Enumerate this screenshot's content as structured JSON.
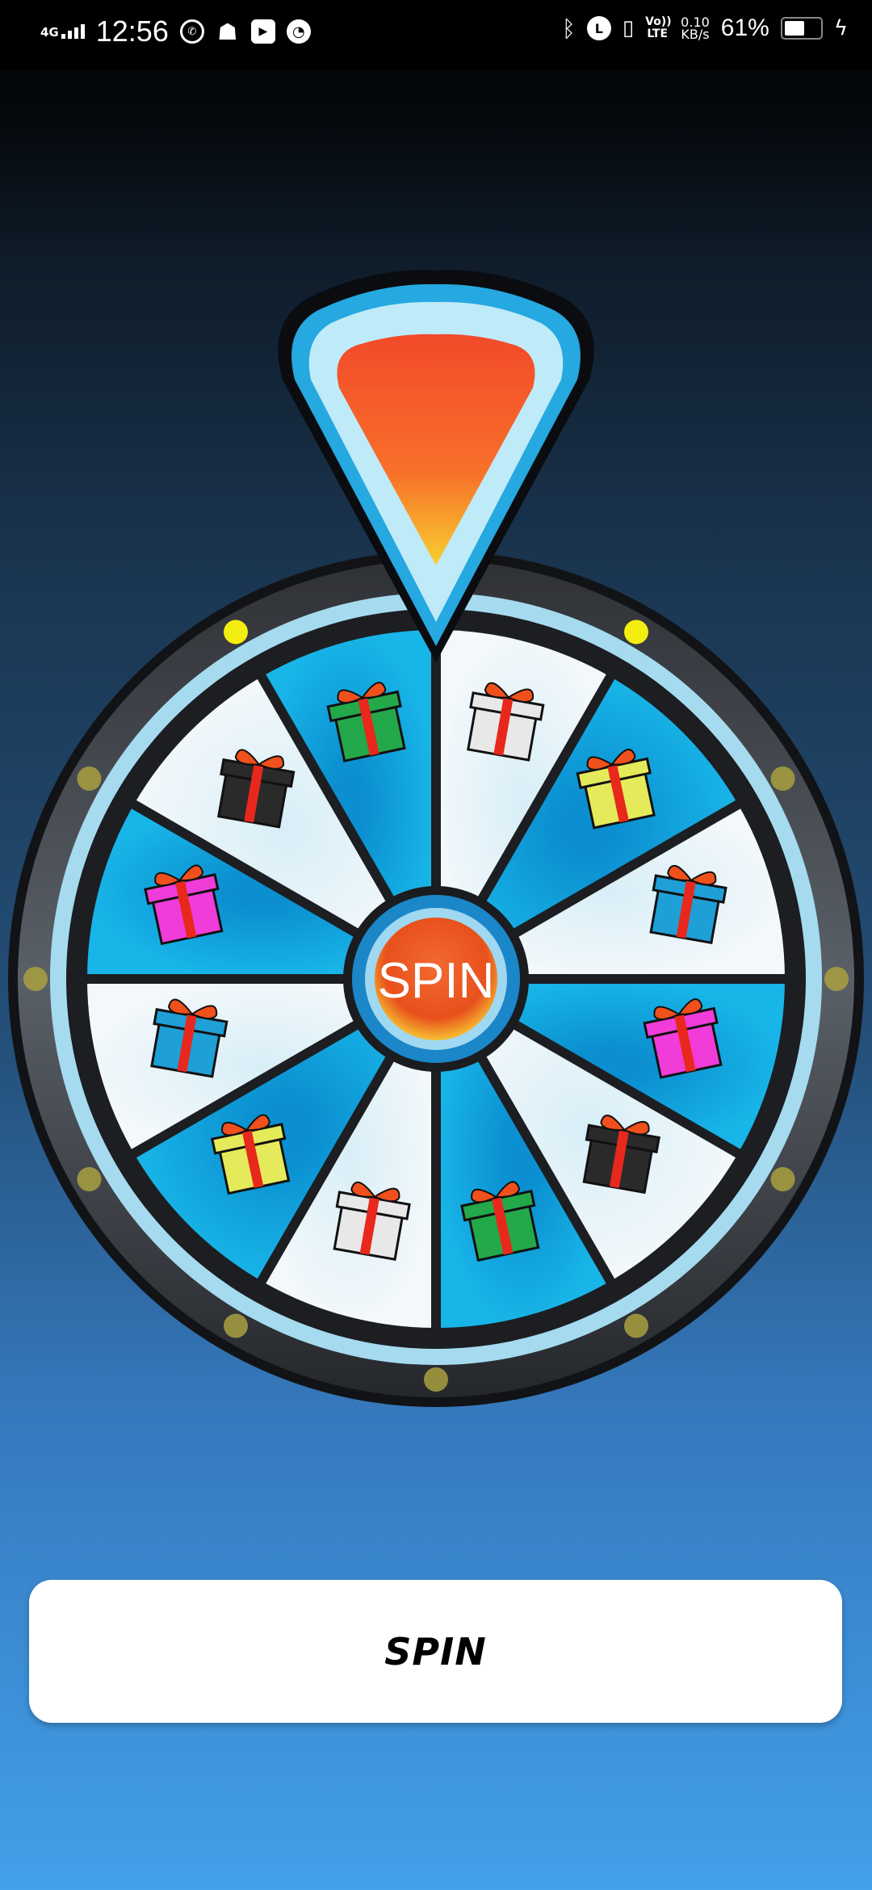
{
  "status_bar": {
    "network": "4G",
    "time": "12:56",
    "app_icons": [
      "whatsapp-icon",
      "snapchat-icon",
      "youtube-icon",
      "speedometer-icon"
    ],
    "system_icons": [
      "bluetooth-icon",
      "alarm-icon",
      "vibrate-icon"
    ],
    "volte": "Vo)) LTE",
    "speed_value": "0.10",
    "speed_unit": "KB/s",
    "battery_percent": "61%",
    "battery_level": 0.61,
    "charging": true
  },
  "wheel": {
    "center_label": "SPIN",
    "colors": {
      "light": "#dbeff7",
      "blue": "#0a9ad8",
      "ring": "#a8dcef",
      "frame": "#2a2c30",
      "hub": "#ef5a24",
      "pointer": "#f25a2a",
      "pointer_frame": "#23a5dc"
    },
    "segments": [
      {
        "shade": "light",
        "gift": "white"
      },
      {
        "shade": "blue",
        "gift": "yellow"
      },
      {
        "shade": "light",
        "gift": "blue"
      },
      {
        "shade": "blue",
        "gift": "pink"
      },
      {
        "shade": "light",
        "gift": "black"
      },
      {
        "shade": "blue",
        "gift": "green"
      },
      {
        "shade": "light",
        "gift": "white"
      },
      {
        "shade": "blue",
        "gift": "yellow"
      },
      {
        "shade": "light",
        "gift": "blue"
      },
      {
        "shade": "blue",
        "gift": "pink"
      },
      {
        "shade": "light",
        "gift": "black"
      },
      {
        "shade": "blue",
        "gift": "green"
      }
    ],
    "gift_colors": {
      "white": "#e8e8e8",
      "yellow": "#e4ea5a",
      "blue": "#1e9fd6",
      "pink": "#f03cd8",
      "black": "#2a2a2a",
      "green": "#23a84a"
    }
  },
  "spin_button": {
    "label": "SPIN"
  }
}
